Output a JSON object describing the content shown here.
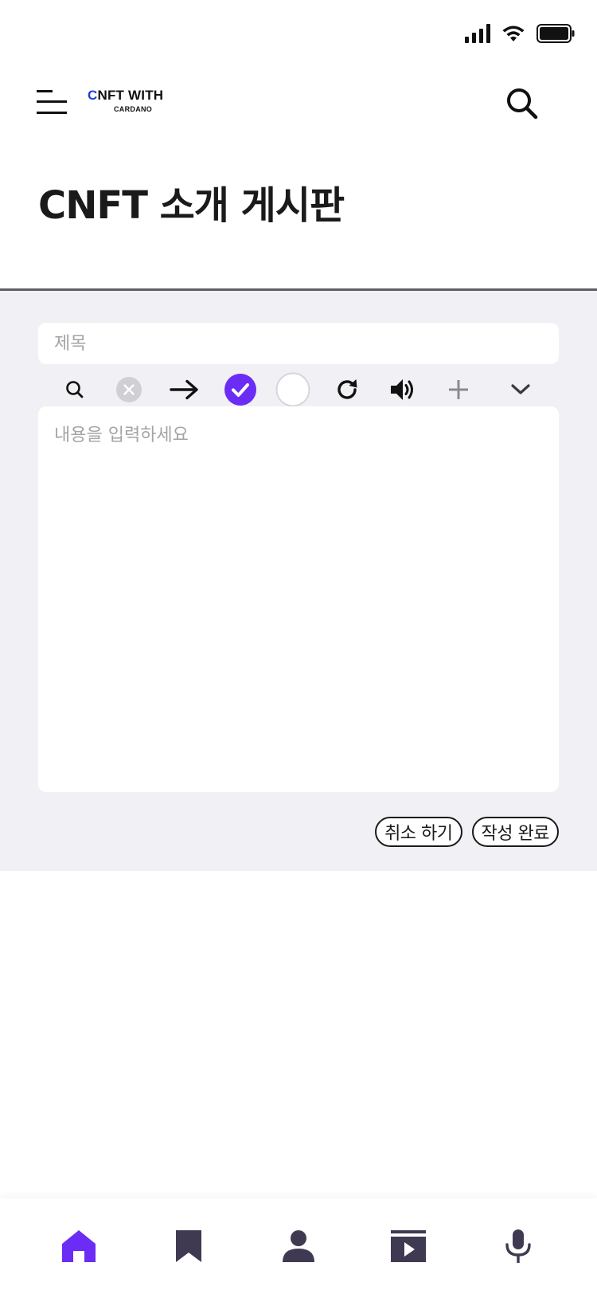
{
  "status_bar": {
    "icons": [
      "signal-icon",
      "wifi-icon",
      "battery-icon"
    ]
  },
  "header": {
    "logo_main_first": "C",
    "logo_main_rest": "NFT WITH",
    "logo_sub": "CARDANO",
    "menu_icon": "hamburger-menu-icon",
    "search_icon": "search-icon"
  },
  "page": {
    "title": "CNFT 소개 게시판"
  },
  "editor": {
    "title_placeholder": "제목",
    "body_placeholder": "내용을 입력하세요",
    "toolbar": [
      "search-icon",
      "clear-icon",
      "arrow-right-icon",
      "check-circle-icon",
      "empty-circle-icon",
      "refresh-icon",
      "volume-icon",
      "plus-icon",
      "chevron-down-icon"
    ],
    "cancel_label": "취소 하기",
    "submit_label": "작성 완료"
  },
  "bottom_nav": {
    "items": [
      "home-icon",
      "bookmark-icon",
      "profile-icon",
      "media-icon",
      "microphone-icon"
    ],
    "active": "home-icon"
  },
  "colors": {
    "accent": "#6b2cf5",
    "panel_bg": "#f0f0f5",
    "nav_icon": "#3f3a52",
    "logo_blue": "#1d3fd8"
  }
}
